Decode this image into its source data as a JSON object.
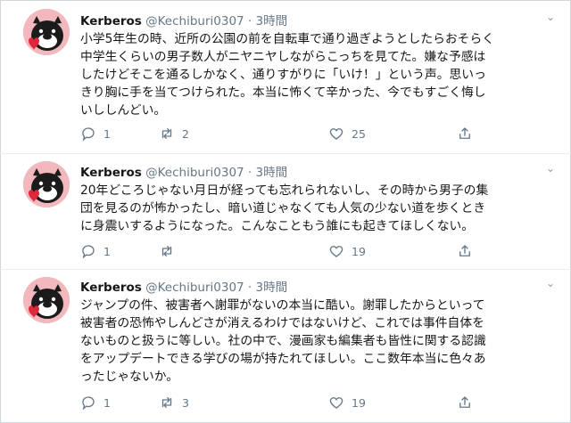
{
  "tweets": [
    {
      "name": "Kerberos",
      "handle": "@Kechiburi0307",
      "separator": "·",
      "time": "3時間",
      "text": "小学5年生の時、近所の公園の前を自転車で通り過ぎようとしたらおそらく\n中学生くらいの男子数人がニヤニヤしながらこっちを見てた。嫌な予感は\nしたけどそこを通るしかなく、通りすがりに「いけ！」という声。思いっ\nきり胸に手を当てつけられた。本当に怖くて辛かった、今でもすごく悔し\nいししんどい。",
      "replies": "1",
      "retweets": "2",
      "likes": "25",
      "share": ""
    },
    {
      "name": "Kerberos",
      "handle": "@Kechiburi0307",
      "separator": "·",
      "time": "3時間",
      "text": "20年どころじゃない月日が経っても忘れられないし、その時から男子の集\n団を見るのが怖かったし、暗い道じゃなくても人気の少ない道を歩くとき\nに身震いするようになった。こんなこともう誰にも起きてほしくない。",
      "replies": "1",
      "retweets": "",
      "likes": "19",
      "share": ""
    },
    {
      "name": "Kerberos",
      "handle": "@Kechiburi0307",
      "separator": "·",
      "time": "3時間",
      "text": "ジャンプの件、被害者へ謝罪がないの本当に酷い。謝罪したからといって\n被害者の恐怖やしんどさが消えるわけではないけど、これでは事件自体を\nないものと扱うに等しい。社の中で、漫画家も編集者も皆性に関する認識\nをアップデートできる学びの場が持たれてほしい。ここ数年本当に色々あ\nったじゃないか。",
      "replies": "1",
      "retweets": "3",
      "likes": "19",
      "share": ""
    }
  ],
  "icons": {
    "avatar": "bulldog-avatar",
    "more": "chevron-down-icon",
    "reply": "reply-icon",
    "retweet": "retweet-icon",
    "like": "heart-icon",
    "share": "share-icon"
  },
  "colors": {
    "text": "#14171a",
    "muted": "#657786",
    "avatar_bg": "#f2b8bd",
    "separator": "#e6ecf0"
  }
}
